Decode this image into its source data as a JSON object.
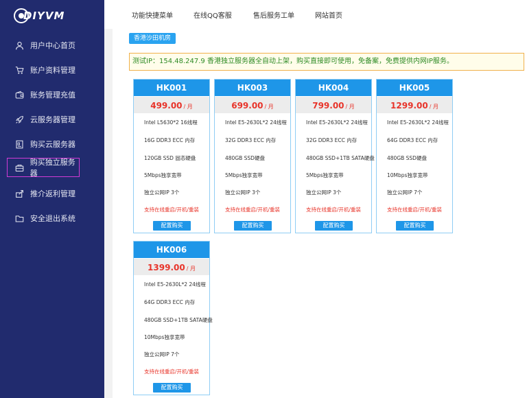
{
  "brand": {
    "logo_text": "DIYVM"
  },
  "sidebar": {
    "items": [
      {
        "label": "用户中心首页",
        "icon": "user-icon"
      },
      {
        "label": "账户资料管理",
        "icon": "cart-icon"
      },
      {
        "label": "账务管理充值",
        "icon": "wallet-icon"
      },
      {
        "label": "云服务器管理",
        "icon": "rocket-icon"
      },
      {
        "label": "购买云服务器",
        "icon": "document-icon"
      },
      {
        "label": "购买独立服务器",
        "icon": "server-bag-icon"
      },
      {
        "label": "推介返利管理",
        "icon": "share-icon"
      },
      {
        "label": "安全退出系统",
        "icon": "folder-icon"
      }
    ]
  },
  "topnav": {
    "items": [
      "功能快捷菜单",
      "在线QQ客服",
      "售后服务工单",
      "网站首页"
    ]
  },
  "region_tag": "香港沙田机房",
  "notice": "测试IP：154.48.247.9 香港独立服务器全自动上架，购买直接即可使用，免备案，免费提供内网IP服务。",
  "cards": [
    {
      "name": "HK001",
      "price": "499.00",
      "unit": "/ 月",
      "specs": [
        "Intel L5630*2 16线程",
        "16G DDR3 ECC 内存",
        "120GB SSD 固态硬盘",
        "5Mbps独享宽带",
        "独立公网IP 3个"
      ],
      "note": "支持在线重启/开机/重装",
      "buy_label": "配置购买"
    },
    {
      "name": "HK003",
      "price": "699.00",
      "unit": "/ 月",
      "specs": [
        "Intel E5-2630L*2 24线程",
        "32G DDR3 ECC 内存",
        "480GB SSD硬盘",
        "5Mbps独享宽带",
        "独立公网IP 3个"
      ],
      "note": "支持在线重启/开机/重装",
      "buy_label": "配置购买"
    },
    {
      "name": "HK004",
      "price": "799.00",
      "unit": "/ 月",
      "specs": [
        "Intel E5-2630L*2 24线程",
        "32G DDR3 ECC 内存",
        "480GB SSD+1TB SATA硬盘",
        "5Mbps独享宽带",
        "独立公网IP 3个"
      ],
      "note": "支持在线重启/开机/重装",
      "buy_label": "配置购买"
    },
    {
      "name": "HK005",
      "price": "1299.00",
      "unit": "/ 月",
      "specs": [
        "Intel E5-2630L*2 24线程",
        "64G DDR3 ECC 内存",
        "480GB SSD硬盘",
        "10Mbps独享宽带",
        "独立公网IP 7个"
      ],
      "note": "支持在线重启/开机/重装",
      "buy_label": "配置购买"
    },
    {
      "name": "HK006",
      "price": "1399.00",
      "unit": "/ 月",
      "specs": [
        "Intel E5-2630L*2 24线程",
        "64G DDR3 ECC 内存",
        "480GB SSD+1TB SATA硬盘",
        "10Mbps独享宽带",
        "独立公网IP 7个"
      ],
      "note": "支持在线重启/开机/重装",
      "buy_label": "配置购买"
    }
  ],
  "colors": {
    "sidebar_bg": "#212b6e",
    "accent_blue": "#1e96e8",
    "price_red": "#e8342a",
    "notice_green": "#2e8b24",
    "notice_border": "#f0b04a",
    "active_outline": "#d33bd6"
  }
}
